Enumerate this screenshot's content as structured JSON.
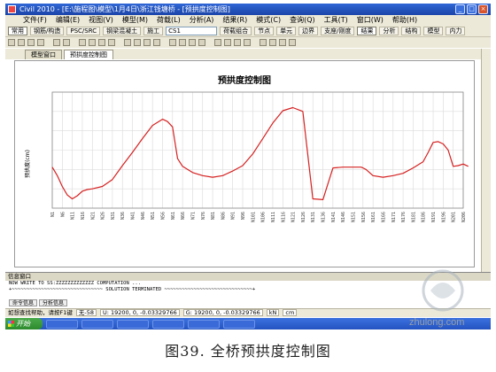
{
  "window": {
    "title": "Civil 2010 - [E:\\施程图\\模型\\1月4日\\浙江钱塘桥 - [预拱度控制图]"
  },
  "menu": [
    "文件(F)",
    "编辑(E)",
    "视图(V)",
    "模型(M)",
    "荷载(L)",
    "分析(A)",
    "结果(R)",
    "模式(C)",
    "查询(Q)",
    "工具(T)",
    "窗口(W)",
    "帮助(H)"
  ],
  "toolbar": {
    "tabs": [
      "常用",
      "钢筋/构造",
      "PSC/SRC",
      "钢梁混凝土",
      "施工"
    ],
    "tabs2": [
      "荷载组合",
      "节点",
      "单元",
      "边界",
      "支座/刚度",
      "结果",
      "分析",
      "结构",
      "模型",
      "内力"
    ],
    "stage_value": "CS1"
  },
  "doc_tabs": [
    "模型窗口",
    "预拱度控制图"
  ],
  "chart_data": {
    "type": "line",
    "title": "预拱度控制图",
    "ylabel": "预拱度(cm)",
    "xlabel": "",
    "grid": true,
    "legend": "none",
    "ylim": [
      -5,
      10
    ],
    "x_tick_labels": [
      "N1",
      "N6",
      "N11",
      "N16",
      "N21",
      "N26",
      "N31",
      "N36",
      "N41",
      "N46",
      "N51",
      "N56",
      "N61",
      "N66",
      "N71",
      "N76",
      "N81",
      "N86",
      "N91",
      "N96",
      "N101",
      "N106",
      "N111",
      "N116",
      "N121",
      "N126",
      "N131",
      "N136",
      "N141",
      "N146",
      "N151",
      "N156",
      "N161",
      "N166",
      "N171",
      "N176",
      "N181",
      "N186",
      "N191",
      "N196",
      "N201",
      "N206"
    ],
    "series": [
      {
        "color": "#d62020",
        "x": [
          0,
          0.5,
          1,
          1.5,
          2,
          2.5,
          3,
          3.5,
          4,
          5,
          6,
          7,
          8,
          9,
          10,
          11,
          11.5,
          12,
          12.5,
          13,
          14,
          15,
          16,
          17,
          18,
          19,
          20,
          21,
          22,
          23,
          24,
          25,
          26,
          27,
          28,
          29,
          30,
          30.5,
          30.8,
          31,
          31.3,
          32,
          33,
          34,
          35,
          36,
          37,
          37.5,
          38,
          38.5,
          39,
          39.5,
          40,
          40.5,
          41,
          41.5
        ],
        "y": [
          0.3,
          -0.8,
          -2.2,
          -3.3,
          -3.8,
          -3.4,
          -2.8,
          -2.6,
          -2.5,
          -2.2,
          -1.3,
          0.5,
          2.2,
          4.0,
          5.7,
          6.5,
          6.2,
          5.5,
          1.4,
          0.4,
          -0.4,
          -0.8,
          -1.0,
          -0.8,
          -0.2,
          0.5,
          2.0,
          4.0,
          6.0,
          7.6,
          8.0,
          7.5,
          -3.8,
          -3.9,
          0.2,
          0.3,
          0.3,
          0.3,
          0.3,
          0.2,
          0.0,
          -0.8,
          -1.0,
          -0.8,
          -0.5,
          0.2,
          1.0,
          2.2,
          3.5,
          3.6,
          3.3,
          2.5,
          0.4,
          0.5,
          0.7,
          0.4
        ]
      }
    ]
  },
  "info_window": {
    "header": "信息窗口",
    "lines": [
      "NOW WRITE TO SS:ZZZZZZZZZZZZZ COMPUTATION ...",
      "+~~~~~~~~~~~~~~~~~~~~~~~~~~~~~~~ SOLUTION TERMINATED ~~~~~~~~~~~~~~~~~~~~~~~~~~~~~~+"
    ],
    "tabs": [
      "命令信息",
      "分析信息"
    ]
  },
  "statusbar": {
    "hint": "如想查找帮助，请按F1键",
    "node": "无-58",
    "coord1": "U: 19200, 0, -0.03329766",
    "coord2": "G: 19200, 0, -0.03329766",
    "unit1": "kN",
    "unit2": "cm"
  },
  "caption": "图39.  全桥预拱度控制图",
  "watermark": "zhulong.com"
}
